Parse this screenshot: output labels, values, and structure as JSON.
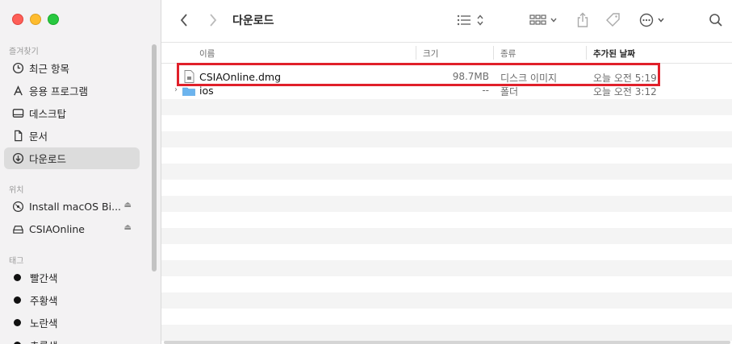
{
  "window": {
    "title": "다운로드"
  },
  "sidebar": {
    "favorites_title": "즐겨찾기",
    "favorites": [
      {
        "label": "최근 항목",
        "icon": "clock-icon"
      },
      {
        "label": "응용 프로그램",
        "icon": "applications-icon"
      },
      {
        "label": "데스크탑",
        "icon": "desktop-icon"
      },
      {
        "label": "문서",
        "icon": "document-icon"
      },
      {
        "label": "다운로드",
        "icon": "download-icon",
        "selected": true
      }
    ],
    "locations_title": "위치",
    "locations": [
      {
        "label": "Install macOS Bi...",
        "icon": "disk-image-icon"
      },
      {
        "label": "CSIAOnline",
        "icon": "drive-icon"
      }
    ],
    "tags_title": "태그",
    "tags": [
      {
        "label": "빨간색",
        "color": "#111111"
      },
      {
        "label": "주황색",
        "color": "#111111"
      },
      {
        "label": "노란색",
        "color": "#111111"
      },
      {
        "label": "초록색",
        "color": "#111111"
      }
    ]
  },
  "columns": {
    "name": "이름",
    "size": "크기",
    "kind": "종류",
    "date": "추가된 날짜"
  },
  "files": [
    {
      "name": "CSIAOnline.dmg",
      "size": "98.7MB",
      "kind": "디스크 이미지",
      "date": "오늘 오전 5:19",
      "icon": "dmg-file-icon"
    },
    {
      "name": "ios",
      "size": "--",
      "kind": "폴더",
      "date": "오늘 오전 3:12",
      "icon": "folder-icon"
    }
  ],
  "colors": {
    "highlight": "#e0202a",
    "selected_sidebar": "#dcdcdc"
  }
}
